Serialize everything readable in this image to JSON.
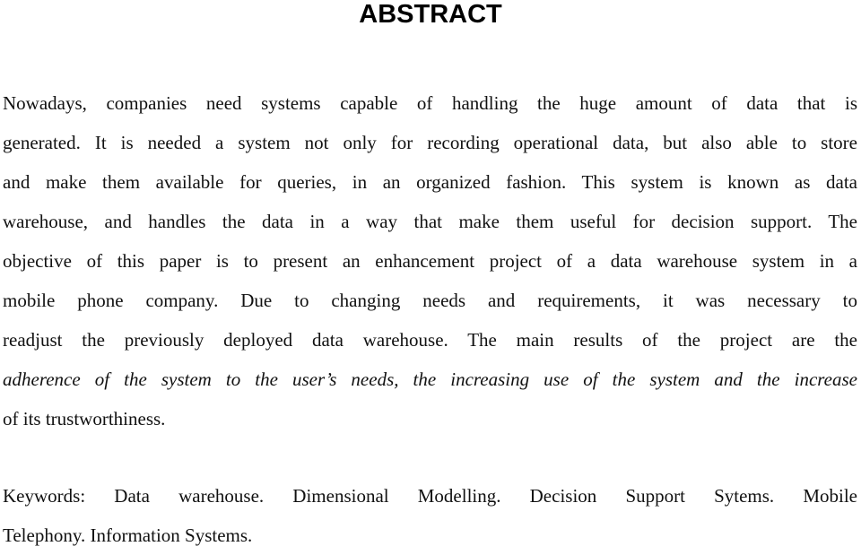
{
  "heading": "ABSTRACT",
  "abstract": {
    "lines": [
      "Nowadays, companies need systems capable of handling the huge amount of data that is",
      "generated. It is needed a system not only for recording operational data, but also able to store",
      "and make them available for queries, in an organized fashion. This system is known as data",
      "warehouse, and handles the data in a way that make them useful for decision support. The",
      "objective of this paper is to present an enhancement project of a data warehouse system in a",
      "mobile phone company. Due to changing needs and requirements, it was necessary to",
      "readjust the previously deployed data warehouse. The main results of the project are the",
      "adherence of the system to the user’s needs, the increasing use of the system and the increase",
      "of its trustworthiness."
    ]
  },
  "keywords": {
    "lines": [
      "Keywords: Data warehouse. Dimensional Modelling. Decision Support Sytems. Mobile",
      "Telephony. Information Systems."
    ]
  }
}
